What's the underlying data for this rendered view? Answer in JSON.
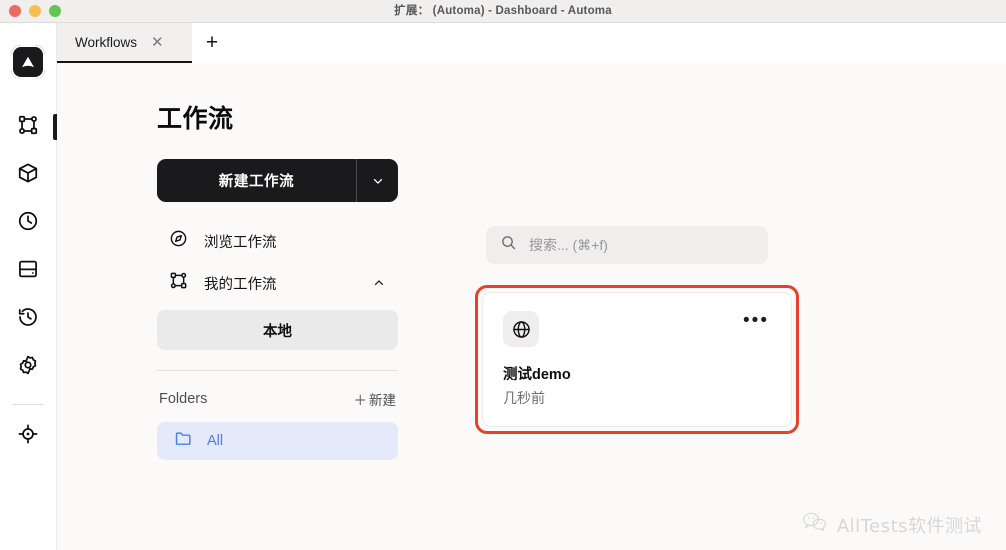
{
  "window": {
    "title": "扩展： (Automa) - Dashboard - Automa",
    "traffic_lights": [
      "close",
      "minimize",
      "zoom"
    ]
  },
  "tabs": {
    "items": [
      {
        "label": "Workflows",
        "active": true,
        "close_glyph": "✕"
      }
    ],
    "add_tab_glyph": "+"
  },
  "rail": {
    "logo_name": "automa-logo",
    "items": [
      {
        "icon": "workflow-sitemap-icon",
        "active": true
      },
      {
        "icon": "package-blocks-icon",
        "active": false
      },
      {
        "icon": "clock-schedule-icon",
        "active": false
      },
      {
        "icon": "storage-table-icon",
        "active": false
      },
      {
        "icon": "history-log-icon",
        "active": false
      },
      {
        "icon": "settings-gear-icon",
        "active": false
      }
    ],
    "bottom_items": [
      {
        "icon": "crosshair-target-icon",
        "active": false
      }
    ]
  },
  "page": {
    "title": "工作流"
  },
  "sidebar": {
    "new_workflow_button": {
      "label": "新建工作流",
      "caret_glyph": "⌄"
    },
    "nav": [
      {
        "label": "浏览工作流",
        "icon": "compass-icon",
        "caret": ""
      },
      {
        "label": "我的工作流",
        "icon": "workflow-sitemap-icon",
        "caret": "⌃"
      }
    ],
    "sub_items": [
      {
        "label": "本地",
        "selected": true
      }
    ],
    "folders": {
      "title": "Folders",
      "new_label": "新建",
      "new_glyph": "＋",
      "items": [
        {
          "label": "All",
          "icon": "folder-icon",
          "selected": true
        }
      ]
    }
  },
  "search": {
    "placeholder": "搜索... (⌘+f)",
    "icon": "search-icon",
    "value": ""
  },
  "workflows": {
    "cards": [
      {
        "name": "测试demo",
        "time": "几秒前",
        "icon": "globe-icon",
        "menu_glyph": "•••",
        "highlighted": true
      }
    ]
  },
  "watermark": {
    "text": "AllTests软件测试",
    "icon": "wechat-icon"
  },
  "colors": {
    "accent_highlight": "#e8402a",
    "button_dark": "#1a1a1c",
    "folder_blue": "#4a80ee",
    "content_bg": "#fbfaf9"
  }
}
